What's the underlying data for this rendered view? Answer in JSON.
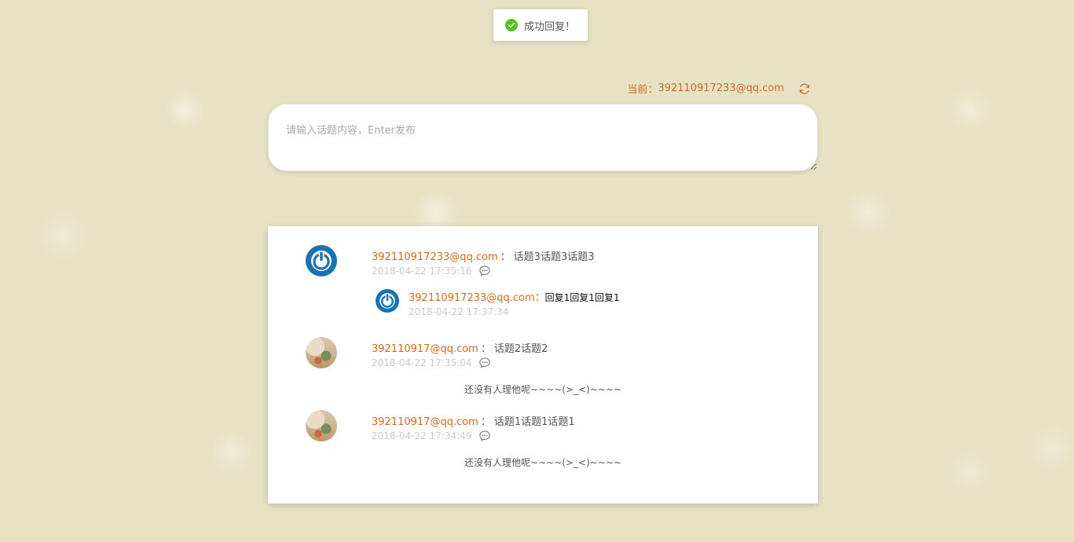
{
  "toast": {
    "icon": "check-circle-icon",
    "message": "成功回复！",
    "color": "#52c41a"
  },
  "header": {
    "current_label": "当前：",
    "current_email": "392110917233@qq.com",
    "refresh_icon": "refresh-icon",
    "accent_color": "#d2691e"
  },
  "composer": {
    "placeholder": "请输入话题内容，Enter发布",
    "value": ""
  },
  "posts": [
    {
      "author": "392110917233@qq.com",
      "separator": "：",
      "content": "话题3话题3话题3",
      "time": "2018-04-22 17:35:16",
      "avatar": "power-icon",
      "replies": [
        {
          "author": "392110917233@qq.com",
          "separator": "：",
          "content": "回复1回复1回复1",
          "time": "2018-04-22 17:37:34",
          "avatar": "power-icon"
        }
      ],
      "empty_text": ""
    },
    {
      "author": "392110917@qq.com",
      "separator": "：",
      "content": "话题2话题2",
      "time": "2018-04-22 17:35:04",
      "avatar": "photo-avatar",
      "replies": [],
      "empty_text": "还没有人理他呢~~~~(>_<)~~~~"
    },
    {
      "author": "392110917@qq.com",
      "separator": "：",
      "content": "话题1话题1话题1",
      "time": "2018-04-22 17:34:49",
      "avatar": "photo-avatar",
      "replies": [],
      "empty_text": "还没有人理他呢~~~~(>_<)~~~~"
    }
  ]
}
